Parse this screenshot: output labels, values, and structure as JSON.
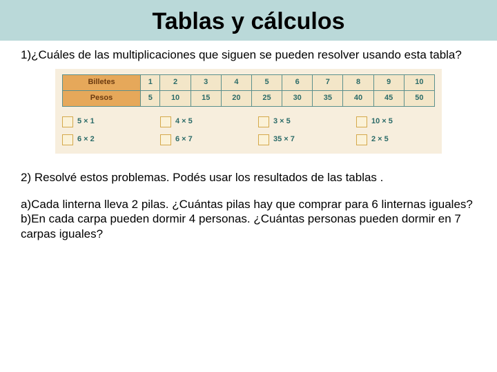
{
  "title": "Tablas y cálculos",
  "q1": "1)¿Cuáles de las multiplicaciones que siguen se pueden resolver usando esta tabla?",
  "table": {
    "row1_label": "Billetes",
    "row2_label": "Pesos",
    "cols": [
      "1",
      "2",
      "3",
      "4",
      "5",
      "6",
      "7",
      "8",
      "9",
      "10"
    ],
    "row2": [
      "5",
      "10",
      "15",
      "20",
      "25",
      "30",
      "35",
      "40",
      "45",
      "50"
    ]
  },
  "options": {
    "r1c1": "5 × 1",
    "r1c2": "4 × 5",
    "r1c3": "3 × 5",
    "r1c4": "10 × 5",
    "r2c1": "6 × 2",
    "r2c2": "6 × 7",
    "r2c3": "35 × 7",
    "r2c4": "2 × 5"
  },
  "q2": "2) Resolvé estos problemas. Podés usar los resultados de las tablas .",
  "q2a": "a)Cada linterna lleva 2 pilas. ¿Cuántas pilas hay que comprar para 6 linternas iguales?",
  "q2b": "b)En cada carpa pueden dormir 4 personas. ¿Cuántas personas pueden dormir en 7 carpas iguales?",
  "chart_data": {
    "type": "table",
    "title": "Billetes vs Pesos (tabla del 5)",
    "columns": [
      "Billetes",
      "Pesos"
    ],
    "rows": [
      [
        1,
        5
      ],
      [
        2,
        10
      ],
      [
        3,
        15
      ],
      [
        4,
        20
      ],
      [
        5,
        25
      ],
      [
        6,
        30
      ],
      [
        7,
        35
      ],
      [
        8,
        40
      ],
      [
        9,
        45
      ],
      [
        10,
        50
      ]
    ]
  }
}
